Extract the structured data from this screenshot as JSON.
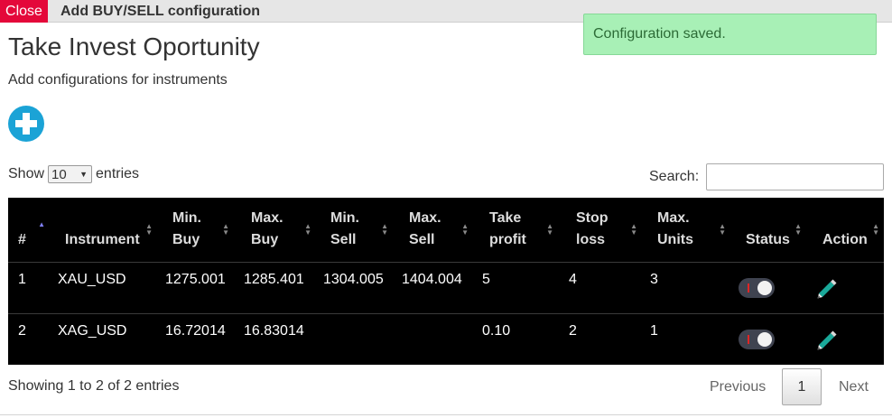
{
  "dialog": {
    "close_label": "Close",
    "title": "Add BUY/SELL configuration"
  },
  "toast": {
    "message": "Configuration saved."
  },
  "page": {
    "title": "Take Invest Oportunity",
    "subtitle": "Add configurations for instruments"
  },
  "length_menu": {
    "prefix": "Show",
    "selected": "10",
    "suffix": "entries"
  },
  "search": {
    "label": "Search:",
    "value": ""
  },
  "table": {
    "columns": [
      "#",
      "Instrument",
      "Min. Buy",
      "Max. Buy",
      "Min. Sell",
      "Max. Sell",
      "Take profit",
      "Stop loss",
      "Max. Units",
      "Status",
      "Action"
    ],
    "rows": [
      {
        "num": "1",
        "instrument": "XAU_USD",
        "min_buy": "1275.001",
        "max_buy": "1285.401",
        "min_sell": "1304.005",
        "max_sell": "1404.004",
        "take_profit": "5",
        "stop_loss": "4",
        "max_units": "3",
        "status": "off"
      },
      {
        "num": "2",
        "instrument": "XAG_USD",
        "min_buy": "16.72014",
        "max_buy": "16.83014",
        "min_sell": "",
        "max_sell": "",
        "take_profit": "0.10",
        "stop_loss": "2",
        "max_units": "1",
        "status": "off"
      }
    ]
  },
  "footer": {
    "info": "Showing 1 to 2 of 2 entries",
    "prev": "Previous",
    "page": "1",
    "next": "Next"
  },
  "colors": {
    "close": "#e4083a",
    "toast_bg": "#a8f0b6",
    "add_icon": "#1ba3d6",
    "table_bg": "#000000"
  },
  "icons": {
    "add": "plus-circle-icon",
    "edit": "pencil-icon",
    "sort": "sort-icon",
    "status": "toggle-switch"
  }
}
